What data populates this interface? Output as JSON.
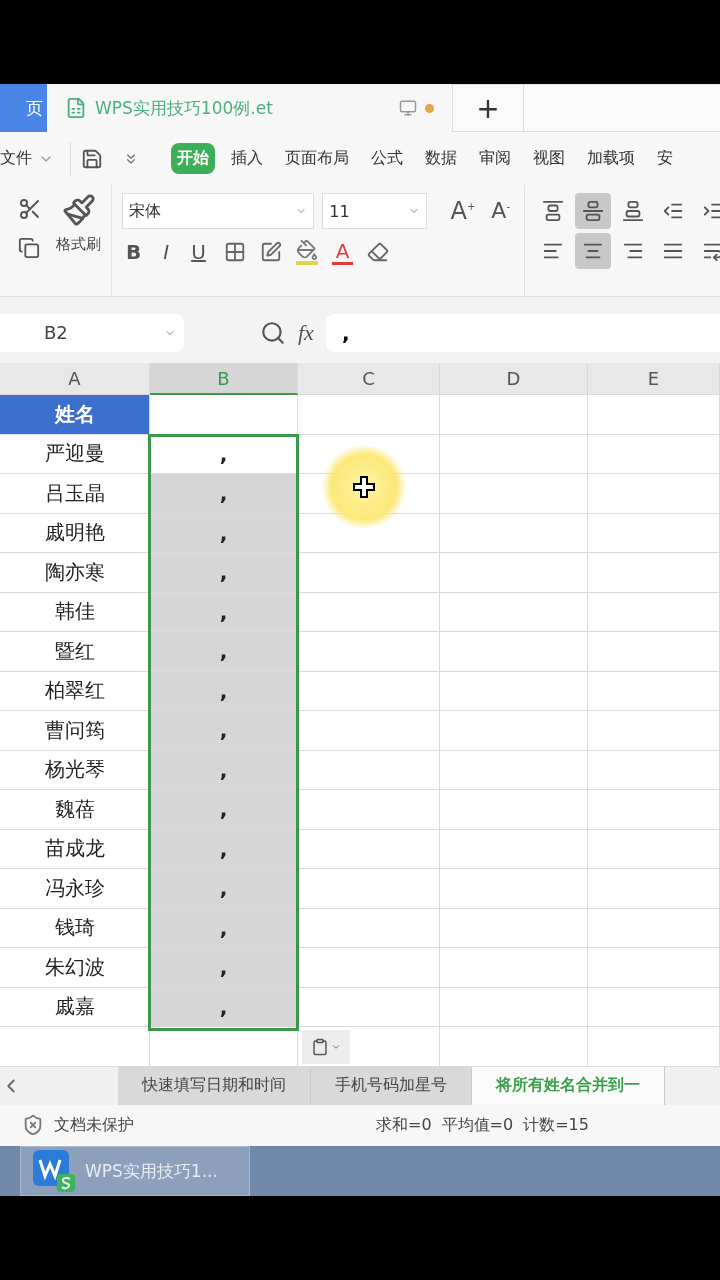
{
  "doc_tabs": [
    {
      "label": "页",
      "selected": false,
      "kind": "home"
    },
    {
      "label": "WPS实用技巧100例.et",
      "selected": true,
      "kind": "sheet"
    }
  ],
  "new_tab": "+",
  "menu": {
    "file": "文件",
    "tabs": [
      {
        "label": "开始",
        "selected": true
      },
      {
        "label": "插入",
        "selected": false
      },
      {
        "label": "页面布局",
        "selected": false
      },
      {
        "label": "公式",
        "selected": false
      },
      {
        "label": "数据",
        "selected": false
      },
      {
        "label": "审阅",
        "selected": false
      },
      {
        "label": "视图",
        "selected": false
      },
      {
        "label": "加载项",
        "selected": false
      },
      {
        "label": "安",
        "selected": false
      }
    ]
  },
  "ribbon": {
    "format_painter": "格式刷",
    "font": "宋体",
    "size": "11",
    "grow": "A",
    "grow_mark": "+",
    "shrink": "A",
    "shrink_mark": "-",
    "bold": "B",
    "italic": "I",
    "underline": "U",
    "font_color": "A",
    "align_top": [
      {
        "kind": "top",
        "selected": false
      },
      {
        "kind": "middle",
        "selected": true
      },
      {
        "kind": "bottom",
        "selected": false
      },
      {
        "kind": "outdent",
        "selected": false
      },
      {
        "kind": "indent",
        "selected": false
      }
    ],
    "align_bottom": [
      {
        "kind": "left",
        "selected": false
      },
      {
        "kind": "center",
        "selected": true
      },
      {
        "kind": "right",
        "selected": false
      },
      {
        "kind": "justify",
        "selected": false
      },
      {
        "kind": "wrap",
        "selected": false
      }
    ]
  },
  "formula_bar": {
    "cell": "B2",
    "fx": "fx",
    "value": ","
  },
  "columns": [
    {
      "label": "A",
      "selected": false
    },
    {
      "label": "B",
      "selected": true
    },
    {
      "label": "C",
      "selected": false
    },
    {
      "label": "D",
      "selected": false
    },
    {
      "label": "E",
      "selected": false
    }
  ],
  "header_cell": "姓名",
  "rows": [
    {
      "name": "严迎曼",
      "value": ",",
      "selected": true,
      "active": true
    },
    {
      "name": "吕玉晶",
      "value": ",",
      "selected": true,
      "active": false
    },
    {
      "name": "戚明艳",
      "value": ",",
      "selected": true,
      "active": false
    },
    {
      "name": "陶亦寒",
      "value": ",",
      "selected": true,
      "active": false
    },
    {
      "name": "韩佳",
      "value": ",",
      "selected": true,
      "active": false
    },
    {
      "name": "暨红",
      "value": ",",
      "selected": true,
      "active": false
    },
    {
      "name": "柏翠红",
      "value": ",",
      "selected": true,
      "active": false
    },
    {
      "name": "曹问筠",
      "value": ",",
      "selected": true,
      "active": false
    },
    {
      "name": "杨光琴",
      "value": ",",
      "selected": true,
      "active": false
    },
    {
      "name": "魏蓓",
      "value": ",",
      "selected": true,
      "active": false
    },
    {
      "name": "苗成龙",
      "value": ",",
      "selected": true,
      "active": false
    },
    {
      "name": "冯永珍",
      "value": ",",
      "selected": true,
      "active": false
    },
    {
      "name": "钱琦",
      "value": ",",
      "selected": true,
      "active": false
    },
    {
      "name": "朱幻波",
      "value": ",",
      "selected": true,
      "active": false
    },
    {
      "name": "戚嘉",
      "value": ",",
      "selected": true,
      "active": false
    }
  ],
  "sheet_tabs": [
    {
      "label": "快速填写日期和时间",
      "selected": false
    },
    {
      "label": "手机号码加星号",
      "selected": false
    },
    {
      "label": "将所有姓名合并到一",
      "selected": true
    }
  ],
  "status_bar": {
    "protection": "文档未保护",
    "sum": "求和=0",
    "average": "平均值=0",
    "count": "计数=15"
  },
  "taskbar": {
    "app": "WPS实用技巧1..."
  }
}
